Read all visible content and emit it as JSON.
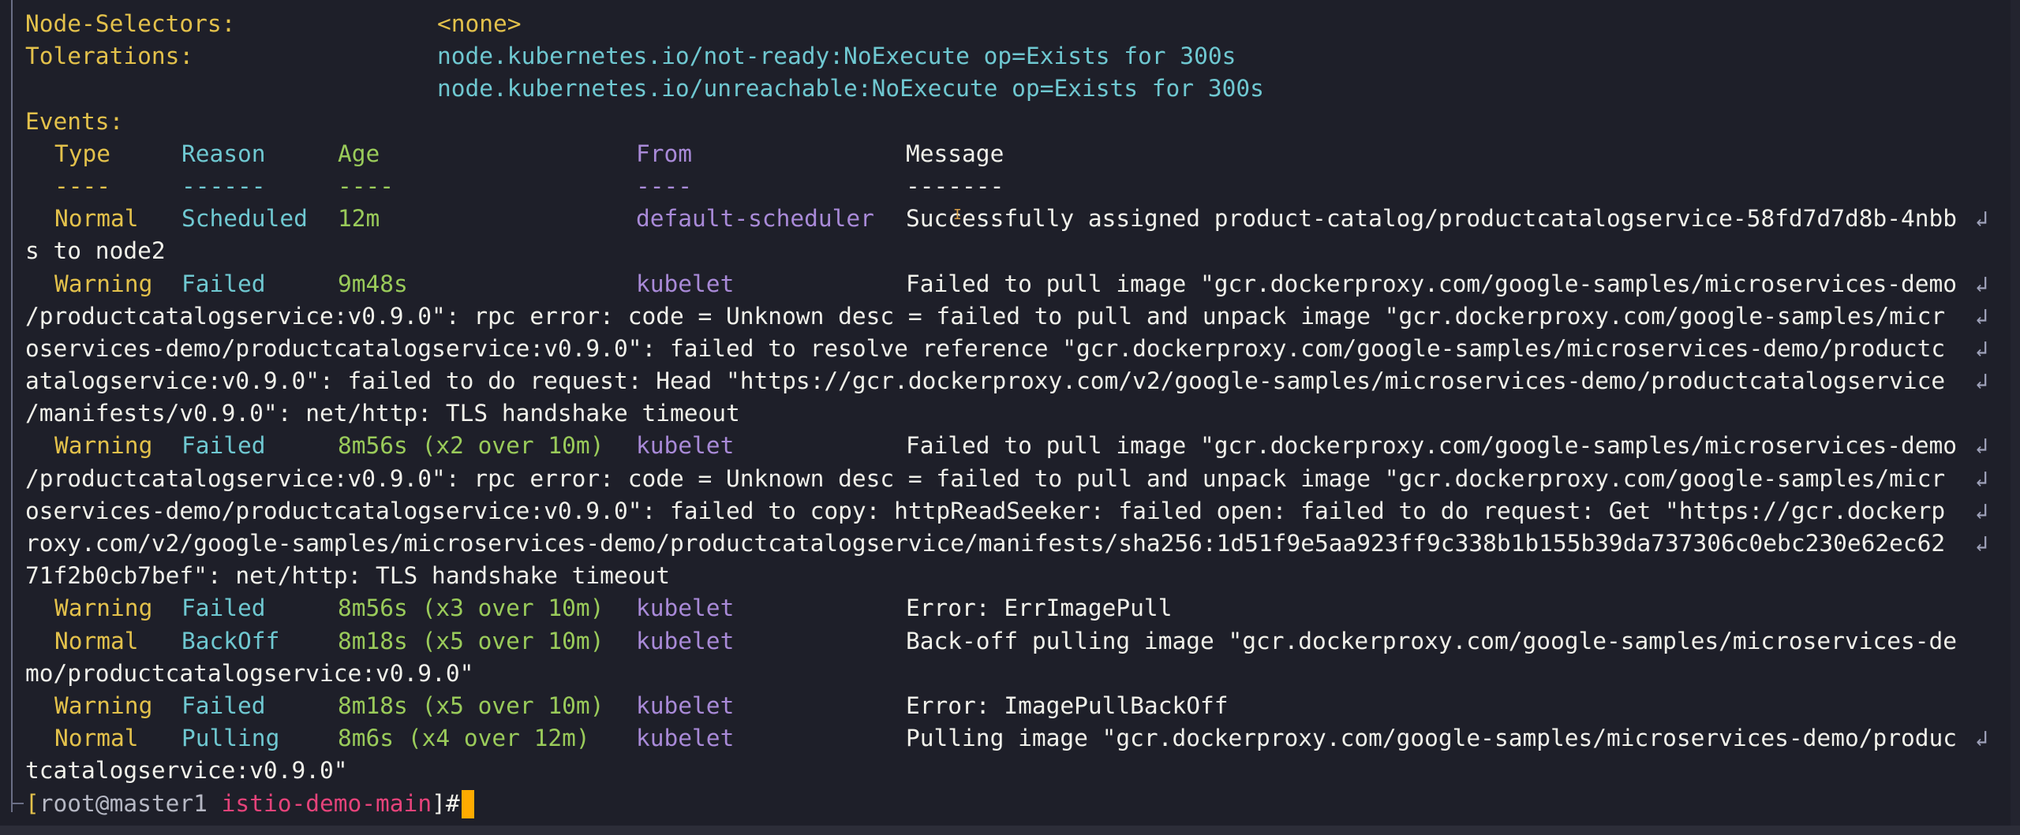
{
  "prompt": {
    "open_bracket": "[",
    "user_host": "root@master1",
    "cwd": "istio-demo-main",
    "close_symbol": "]#"
  },
  "header": {
    "node_selectors_label": "Node-Selectors:",
    "node_selectors_value": "<none>",
    "tolerations_label": "Tolerations:",
    "toleration_1": "node.kubernetes.io/not-ready:NoExecute op=Exists for 300s",
    "toleration_2": "node.kubernetes.io/unreachable:NoExecute op=Exists for 300s",
    "events_label": "Events:"
  },
  "events": {
    "columns": [
      "Type",
      "Reason",
      "Age",
      "From",
      "Message"
    ],
    "dashes": [
      "----",
      "------",
      "----",
      "----",
      "-------"
    ],
    "rows": [
      {
        "type": "Normal",
        "reason": "Scheduled",
        "age": "12m",
        "from": "default-scheduler",
        "message_lines": [
          "Successfully assigned product-catalog/productcatalogservice-58fd7d7d8b-4nbb",
          "s to node2"
        ]
      },
      {
        "type": "Warning",
        "reason": "Failed",
        "age": "9m48s",
        "from": "kubelet",
        "message_lines": [
          "Failed to pull image \"gcr.dockerproxy.com/google-samples/microservices-demo",
          "/productcatalogservice:v0.9.0\": rpc error: code = Unknown desc = failed to pull and unpack image \"gcr.dockerproxy.com/google-samples/micr",
          "oservices-demo/productcatalogservice:v0.9.0\": failed to resolve reference \"gcr.dockerproxy.com/google-samples/microservices-demo/productc",
          "atalogservice:v0.9.0\": failed to do request: Head \"https://gcr.dockerproxy.com/v2/google-samples/microservices-demo/productcatalogservice",
          "/manifests/v0.9.0\": net/http: TLS handshake timeout"
        ]
      },
      {
        "type": "Warning",
        "reason": "Failed",
        "age": "8m56s (x2 over 10m)",
        "from": "kubelet",
        "message_lines": [
          "Failed to pull image \"gcr.dockerproxy.com/google-samples/microservices-demo",
          "/productcatalogservice:v0.9.0\": rpc error: code = Unknown desc = failed to pull and unpack image \"gcr.dockerproxy.com/google-samples/micr",
          "oservices-demo/productcatalogservice:v0.9.0\": failed to copy: httpReadSeeker: failed open: failed to do request: Get \"https://gcr.dockerp",
          "roxy.com/v2/google-samples/microservices-demo/productcatalogservice/manifests/sha256:1d51f9e5aa923ff9c338b1b155b39da737306c0ebc230e62ec62",
          "71f2b0cb7bef\": net/http: TLS handshake timeout"
        ]
      },
      {
        "type": "Warning",
        "reason": "Failed",
        "age": "8m56s (x3 over 10m)",
        "from": "kubelet",
        "message_lines": [
          "Error: ErrImagePull"
        ]
      },
      {
        "type": "Normal",
        "reason": "BackOff",
        "age": "8m18s (x5 over 10m)",
        "from": "kubelet",
        "message_lines": [
          "Back-off pulling image \"gcr.dockerproxy.com/google-samples/microservices-de",
          "mo/productcatalogservice:v0.9.0\""
        ]
      },
      {
        "type": "Warning",
        "reason": "Failed",
        "age": "8m18s (x5 over 10m)",
        "from": "kubelet",
        "message_lines": [
          "Error: ImagePullBackOff"
        ]
      },
      {
        "type": "Normal",
        "reason": "Pulling",
        "age": "8m6s (x4 over 12m)",
        "from": "kubelet",
        "message_lines": [
          "Pulling image \"gcr.dockerproxy.com/google-samples/microservices-demo/produc",
          "tcatalogservice:v0.9.0\""
        ]
      }
    ]
  },
  "icons": {
    "wrap": "line-wrap-icon",
    "wrap_glyph": "↲",
    "cursor": "text-cursor"
  },
  "colors": {
    "background": "#1e1f29",
    "label_yellow": "#e3c14b",
    "value_cyan": "#6fc8d1",
    "age_green": "#9acb5a",
    "from_purple": "#a98ad8",
    "cursor_orange": "#ffab00",
    "cwd_pink": "#e5437a"
  }
}
